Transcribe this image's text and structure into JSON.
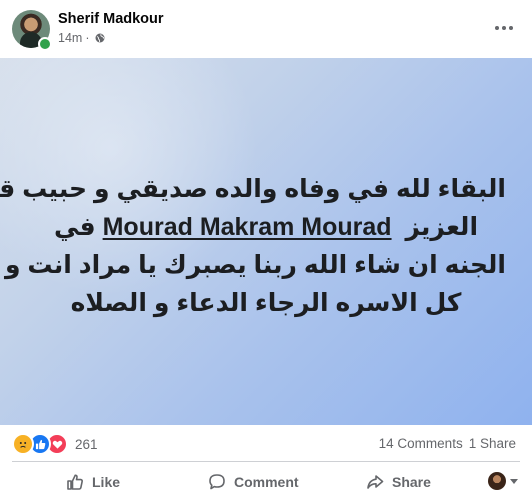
{
  "header": {
    "author": "Sherif Madkour",
    "timestamp": "14m",
    "privacy_icon": "globe-icon",
    "more_icon": "ellipsis-icon"
  },
  "post": {
    "background": [
      "#d7e0ec",
      "#8fb2ee"
    ],
    "line1": "البقاء لله في وفاه والده صديقي و حبيب قلبي",
    "line2_prefix": "العزيز",
    "line2_name": "Mourad Makram Mourad",
    "line2_suffix": "في",
    "line3": "الجنه ان شاء الله ربنا يصبرك يا مراد انت و",
    "line4": "كل الاسره الرجاء الدعاء و الصلاه"
  },
  "reactions": {
    "icons": [
      "sad-icon",
      "like-icon",
      "love-icon"
    ],
    "count": "261"
  },
  "counts": {
    "comments": "14 Comments",
    "shares": "1 Share"
  },
  "actions": {
    "like_label": "Like",
    "comment_label": "Comment",
    "share_label": "Share"
  },
  "colors": {
    "secondary_text": "#65676b",
    "facebook_blue": "#1877f2",
    "online_green": "#31a24c"
  }
}
